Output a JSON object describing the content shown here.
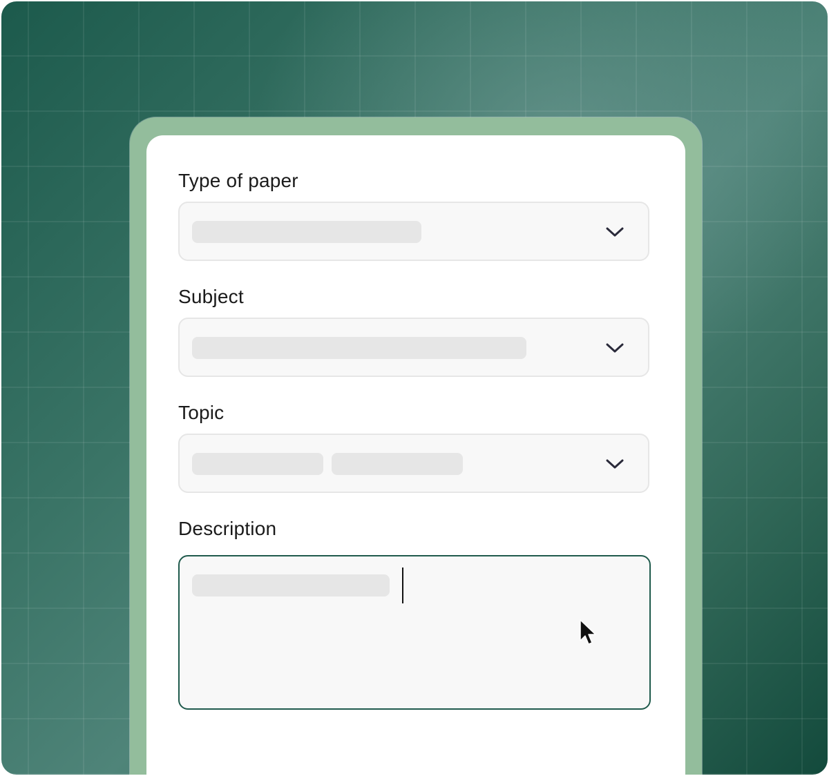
{
  "form": {
    "fields": [
      {
        "label": "Type of paper",
        "control": "dropdown",
        "icon": "chevron-down-icon"
      },
      {
        "label": "Subject",
        "control": "dropdown",
        "icon": "chevron-down-icon"
      },
      {
        "label": "Topic",
        "control": "dropdown",
        "icon": "chevron-down-icon"
      },
      {
        "label": "Description",
        "control": "textarea",
        "state": "focused"
      }
    ]
  },
  "colors": {
    "background_dark_green": "#1c5a4c",
    "card_border_green": "#93bd9c",
    "field_background": "#f8f8f8",
    "skeleton_placeholder": "#e6e6e6",
    "focus_border": "#1f5a4c",
    "chevron": "#2a2a3a"
  },
  "icons": {
    "dropdown": "chevron-down-icon",
    "pointer": "mouse-pointer-icon",
    "text_caret": "text-caret"
  }
}
